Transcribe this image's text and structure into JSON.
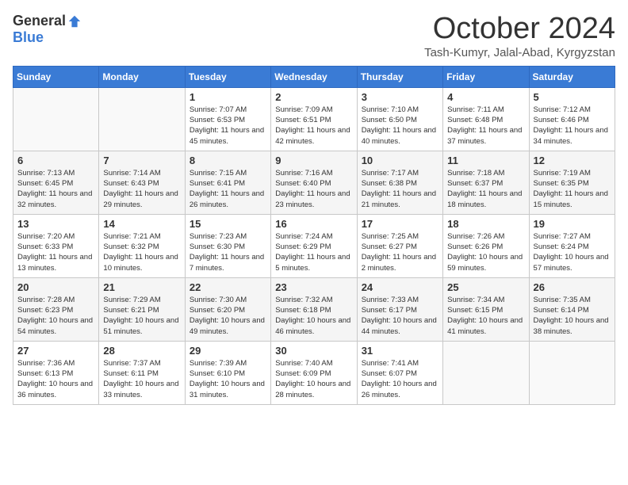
{
  "logo": {
    "general": "General",
    "blue": "Blue"
  },
  "title": "October 2024",
  "location": "Tash-Kumyr, Jalal-Abad, Kyrgyzstan",
  "days_of_week": [
    "Sunday",
    "Monday",
    "Tuesday",
    "Wednesday",
    "Thursday",
    "Friday",
    "Saturday"
  ],
  "weeks": [
    [
      {
        "day": "",
        "info": ""
      },
      {
        "day": "",
        "info": ""
      },
      {
        "day": "1",
        "info": "Sunrise: 7:07 AM\nSunset: 6:53 PM\nDaylight: 11 hours and 45 minutes."
      },
      {
        "day": "2",
        "info": "Sunrise: 7:09 AM\nSunset: 6:51 PM\nDaylight: 11 hours and 42 minutes."
      },
      {
        "day": "3",
        "info": "Sunrise: 7:10 AM\nSunset: 6:50 PM\nDaylight: 11 hours and 40 minutes."
      },
      {
        "day": "4",
        "info": "Sunrise: 7:11 AM\nSunset: 6:48 PM\nDaylight: 11 hours and 37 minutes."
      },
      {
        "day": "5",
        "info": "Sunrise: 7:12 AM\nSunset: 6:46 PM\nDaylight: 11 hours and 34 minutes."
      }
    ],
    [
      {
        "day": "6",
        "info": "Sunrise: 7:13 AM\nSunset: 6:45 PM\nDaylight: 11 hours and 32 minutes."
      },
      {
        "day": "7",
        "info": "Sunrise: 7:14 AM\nSunset: 6:43 PM\nDaylight: 11 hours and 29 minutes."
      },
      {
        "day": "8",
        "info": "Sunrise: 7:15 AM\nSunset: 6:41 PM\nDaylight: 11 hours and 26 minutes."
      },
      {
        "day": "9",
        "info": "Sunrise: 7:16 AM\nSunset: 6:40 PM\nDaylight: 11 hours and 23 minutes."
      },
      {
        "day": "10",
        "info": "Sunrise: 7:17 AM\nSunset: 6:38 PM\nDaylight: 11 hours and 21 minutes."
      },
      {
        "day": "11",
        "info": "Sunrise: 7:18 AM\nSunset: 6:37 PM\nDaylight: 11 hours and 18 minutes."
      },
      {
        "day": "12",
        "info": "Sunrise: 7:19 AM\nSunset: 6:35 PM\nDaylight: 11 hours and 15 minutes."
      }
    ],
    [
      {
        "day": "13",
        "info": "Sunrise: 7:20 AM\nSunset: 6:33 PM\nDaylight: 11 hours and 13 minutes."
      },
      {
        "day": "14",
        "info": "Sunrise: 7:21 AM\nSunset: 6:32 PM\nDaylight: 11 hours and 10 minutes."
      },
      {
        "day": "15",
        "info": "Sunrise: 7:23 AM\nSunset: 6:30 PM\nDaylight: 11 hours and 7 minutes."
      },
      {
        "day": "16",
        "info": "Sunrise: 7:24 AM\nSunset: 6:29 PM\nDaylight: 11 hours and 5 minutes."
      },
      {
        "day": "17",
        "info": "Sunrise: 7:25 AM\nSunset: 6:27 PM\nDaylight: 11 hours and 2 minutes."
      },
      {
        "day": "18",
        "info": "Sunrise: 7:26 AM\nSunset: 6:26 PM\nDaylight: 10 hours and 59 minutes."
      },
      {
        "day": "19",
        "info": "Sunrise: 7:27 AM\nSunset: 6:24 PM\nDaylight: 10 hours and 57 minutes."
      }
    ],
    [
      {
        "day": "20",
        "info": "Sunrise: 7:28 AM\nSunset: 6:23 PM\nDaylight: 10 hours and 54 minutes."
      },
      {
        "day": "21",
        "info": "Sunrise: 7:29 AM\nSunset: 6:21 PM\nDaylight: 10 hours and 51 minutes."
      },
      {
        "day": "22",
        "info": "Sunrise: 7:30 AM\nSunset: 6:20 PM\nDaylight: 10 hours and 49 minutes."
      },
      {
        "day": "23",
        "info": "Sunrise: 7:32 AM\nSunset: 6:18 PM\nDaylight: 10 hours and 46 minutes."
      },
      {
        "day": "24",
        "info": "Sunrise: 7:33 AM\nSunset: 6:17 PM\nDaylight: 10 hours and 44 minutes."
      },
      {
        "day": "25",
        "info": "Sunrise: 7:34 AM\nSunset: 6:15 PM\nDaylight: 10 hours and 41 minutes."
      },
      {
        "day": "26",
        "info": "Sunrise: 7:35 AM\nSunset: 6:14 PM\nDaylight: 10 hours and 38 minutes."
      }
    ],
    [
      {
        "day": "27",
        "info": "Sunrise: 7:36 AM\nSunset: 6:13 PM\nDaylight: 10 hours and 36 minutes."
      },
      {
        "day": "28",
        "info": "Sunrise: 7:37 AM\nSunset: 6:11 PM\nDaylight: 10 hours and 33 minutes."
      },
      {
        "day": "29",
        "info": "Sunrise: 7:39 AM\nSunset: 6:10 PM\nDaylight: 10 hours and 31 minutes."
      },
      {
        "day": "30",
        "info": "Sunrise: 7:40 AM\nSunset: 6:09 PM\nDaylight: 10 hours and 28 minutes."
      },
      {
        "day": "31",
        "info": "Sunrise: 7:41 AM\nSunset: 6:07 PM\nDaylight: 10 hours and 26 minutes."
      },
      {
        "day": "",
        "info": ""
      },
      {
        "day": "",
        "info": ""
      }
    ]
  ]
}
